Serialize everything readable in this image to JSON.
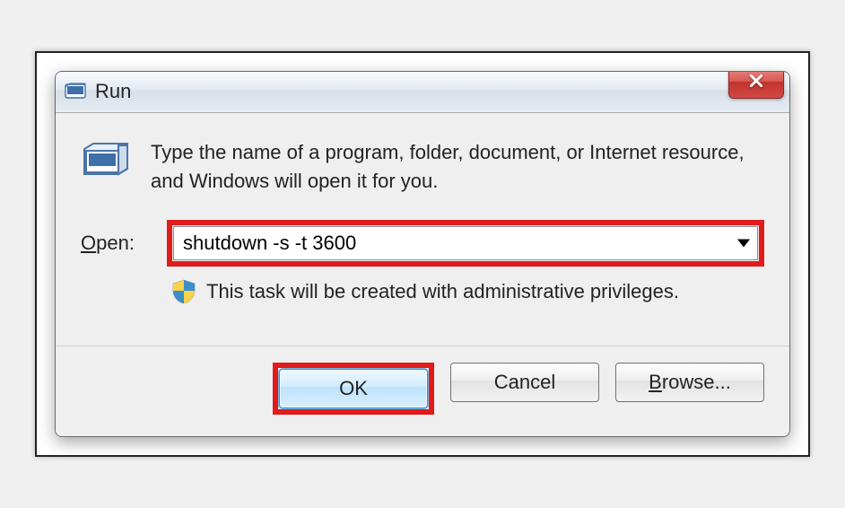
{
  "window": {
    "title": "Run"
  },
  "content": {
    "description": "Type the name of a program, folder, document, or Internet resource, and Windows will open it for you.",
    "open_label_underlined_char": "O",
    "open_label_rest": "pen:",
    "command_value": "shutdown -s -t 3600",
    "admin_note": "This task will be created with administrative privileges."
  },
  "buttons": {
    "ok": "OK",
    "cancel": "Cancel",
    "browse_underlined_char": "B",
    "browse_rest": "rowse..."
  }
}
